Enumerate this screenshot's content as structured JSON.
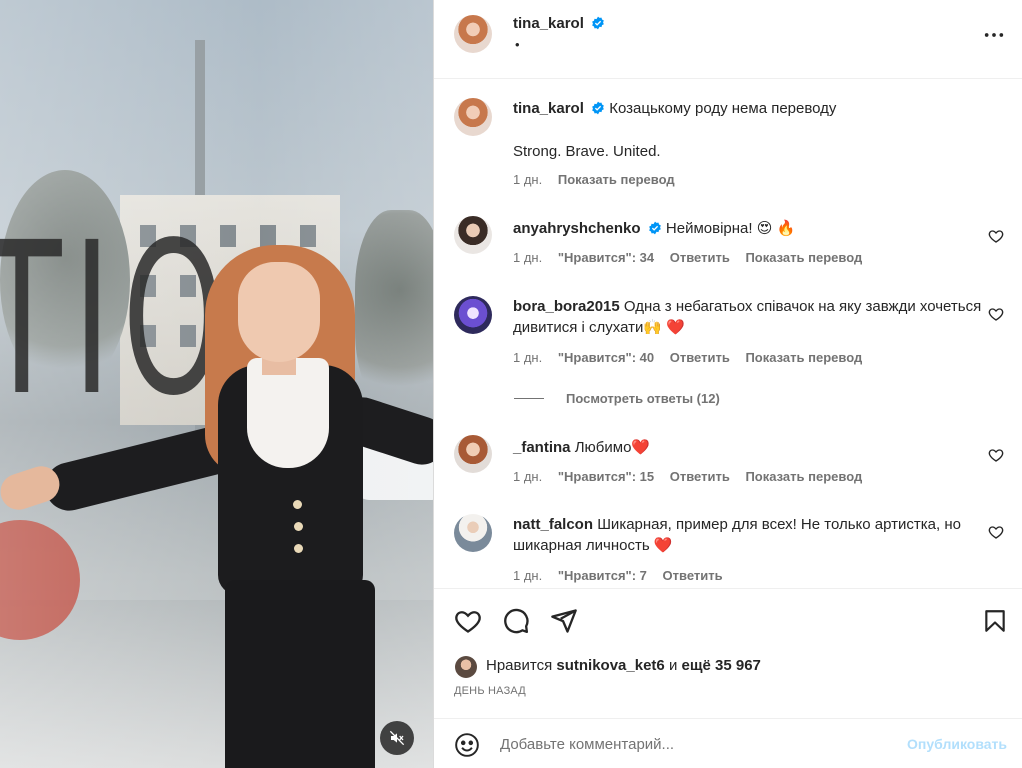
{
  "post": {
    "author": "tina_karol",
    "dot": "•",
    "caption": "Козацькому роду нема переводу",
    "caption_line2": "Strong. Brave. United.",
    "caption_time": "1 дн.",
    "caption_translate": "Показать перевод",
    "media_text": "TIO"
  },
  "comments": [
    {
      "user": "anyahryshchenko",
      "verified": true,
      "text": "Неймовірна! 😍 🔥",
      "time": "1 дн.",
      "likes": "\"Нравится\": 34",
      "reply": "Ответить",
      "translate": "Показать перевод"
    },
    {
      "user": "bora_bora2015",
      "verified": false,
      "text": "Одна з небагатьох співачок на яку завжди хочеться дивитися і слухати🙌 ❤️",
      "time": "1 дн.",
      "likes": "\"Нравится\": 40",
      "reply": "Ответить",
      "translate": "Показать перевод"
    },
    {
      "user": "_fantina",
      "verified": false,
      "text": "Любимо❤️",
      "time": "1 дн.",
      "likes": "\"Нравится\": 15",
      "reply": "Ответить",
      "translate": "Показать перевод"
    },
    {
      "user": "natt_falcon",
      "verified": false,
      "text": "Шикарная, пример для всех! Не только артистка, но шикарная личность ❤️",
      "time": "1 дн.",
      "likes": "\"Нравится\": 7",
      "reply": "Ответить",
      "translate": ""
    }
  ],
  "view_replies": "Посмотреть ответы (12)",
  "likes_prefix": "Нравится",
  "likes_user": "sutnikova_ket6",
  "likes_and": "и",
  "likes_rest": "ещё 35 967",
  "date": "ДЕНЬ НАЗАД",
  "comment_placeholder": "Добавьте комментарий...",
  "publish_label": "Опубликовать",
  "icons": {
    "verified": "verified-badge-icon",
    "more": "more-options-icon",
    "like": "heart-icon",
    "comment": "comment-icon",
    "share": "share-icon",
    "save": "bookmark-icon",
    "emoji": "emoji-icon",
    "mute": "muted-speaker-icon"
  },
  "colors": {
    "verified": "#0095f6",
    "publish_disabled": "#b2dffc",
    "muted_text": "#737373"
  }
}
